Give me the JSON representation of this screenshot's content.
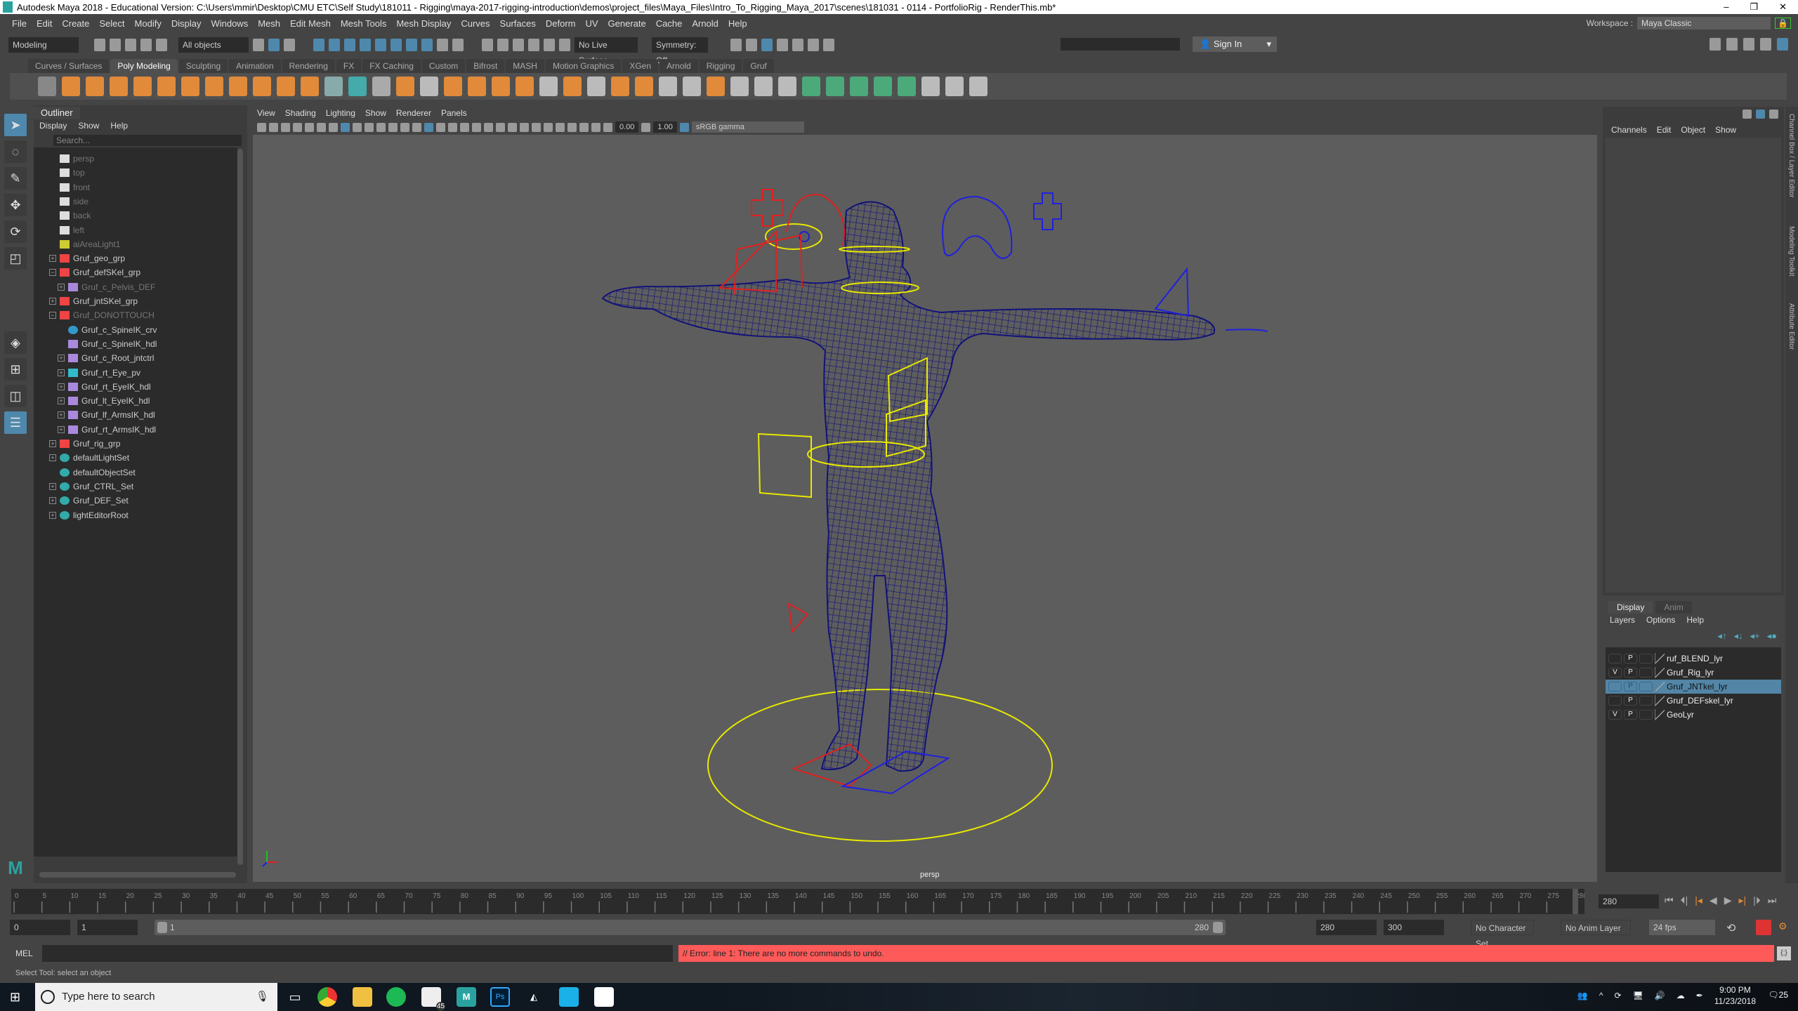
{
  "window": {
    "title": "Autodesk Maya 2018 - Educational Version: C:\\Users\\mmir\\Desktop\\CMU ETC\\Self Study\\181011 - Rigging\\maya-2017-rigging-introduction\\demos\\project_files\\Maya_Files\\Intro_To_Rigging_Maya_2017\\scenes\\181031 - 0114 - PortfolioRig - RenderThis.mb*",
    "logo": "M"
  },
  "menubar": [
    "File",
    "Edit",
    "Create",
    "Select",
    "Modify",
    "Display",
    "Windows",
    "Mesh",
    "Edit Mesh",
    "Mesh Tools",
    "Mesh Display",
    "Curves",
    "Surfaces",
    "Deform",
    "UV",
    "Generate",
    "Cache",
    "Arnold",
    "Help"
  ],
  "workspace": {
    "label": "Workspace :",
    "value": "Maya Classic"
  },
  "statusline": {
    "mode": "Modeling",
    "selection_mask": "All objects",
    "live_surface": "No Live Surface",
    "symmetry": "Symmetry: Off",
    "sign_in": "Sign In"
  },
  "shelf": {
    "tabs": [
      "Curves / Surfaces",
      "Poly Modeling",
      "Sculpting",
      "Animation",
      "Rendering",
      "FX",
      "FX Caching",
      "Custom",
      "Bifrost",
      "MASH",
      "Motion Graphics",
      "XGen",
      "Arnold",
      "Rigging",
      "Gruf"
    ],
    "active_tab": "Poly Modeling",
    "icon_colors": [
      "#888",
      "#e08a3a",
      "#e08a3a",
      "#e08a3a",
      "#e08a3a",
      "#e08a3a",
      "#e08a3a",
      "#e08a3a",
      "#e08a3a",
      "#e08a3a",
      "#e08a3a",
      "#e08a3a",
      "#8aa",
      "#4aa",
      "#aaa",
      "#e08a3a",
      "#bbb",
      "#e08a3a",
      "#e08a3a",
      "#e08a3a",
      "#e08a3a",
      "#bbb",
      "#e08a3a",
      "#bbb",
      "#e08a3a",
      "#e08a3a",
      "#bbb",
      "#bbb",
      "#e08a3a",
      "#bbb",
      "#bbb",
      "#bbb",
      "#4caa7a",
      "#4caa7a",
      "#4caa7a",
      "#4caa7a",
      "#4caa7a",
      "#bbb",
      "#bbb",
      "#bbb"
    ]
  },
  "outliner": {
    "title": "Outliner",
    "menu": [
      "Display",
      "Show",
      "Help"
    ],
    "search_placeholder": "Search...",
    "items": [
      {
        "name": "persp",
        "type": "camera",
        "depth": 0,
        "dim": true,
        "exp": ""
      },
      {
        "name": "top",
        "type": "camera",
        "depth": 0,
        "dim": true,
        "exp": ""
      },
      {
        "name": "front",
        "type": "camera",
        "depth": 0,
        "dim": true,
        "exp": ""
      },
      {
        "name": "side",
        "type": "camera",
        "depth": 0,
        "dim": true,
        "exp": ""
      },
      {
        "name": "back",
        "type": "camera",
        "depth": 0,
        "dim": true,
        "exp": ""
      },
      {
        "name": "left",
        "type": "camera",
        "depth": 0,
        "dim": true,
        "exp": ""
      },
      {
        "name": "aiAreaLight1",
        "type": "light",
        "depth": 0,
        "dim": true,
        "exp": ""
      },
      {
        "name": "Gruf_geo_grp",
        "type": "group",
        "depth": 0,
        "dim": false,
        "exp": "+"
      },
      {
        "name": "Gruf_defSKel_grp",
        "type": "group",
        "depth": 0,
        "dim": false,
        "exp": "-"
      },
      {
        "name": "Gruf_c_Pelvis_DEF",
        "type": "joint",
        "depth": 1,
        "dim": true,
        "exp": "+"
      },
      {
        "name": "Gruf_jntSKel_grp",
        "type": "group",
        "depth": 0,
        "dim": false,
        "exp": "+"
      },
      {
        "name": "Gruf_DONOTTOUCH",
        "type": "group",
        "depth": 0,
        "dim": true,
        "exp": "-"
      },
      {
        "name": "Gruf_c_SpineIK_crv",
        "type": "curve",
        "depth": 1,
        "dim": false,
        "exp": ""
      },
      {
        "name": "Gruf_c_SpineIK_hdl",
        "type": "ikhandle",
        "depth": 1,
        "dim": false,
        "exp": ""
      },
      {
        "name": "Gruf_c_Root_jntctrl",
        "type": "joint",
        "depth": 1,
        "dim": false,
        "exp": "+"
      },
      {
        "name": "Gruf_rt_Eye_pv",
        "type": "locator",
        "depth": 1,
        "dim": false,
        "exp": "+"
      },
      {
        "name": "Gruf_rt_EyeIK_hdl",
        "type": "ikhandle",
        "depth": 1,
        "dim": false,
        "exp": "+"
      },
      {
        "name": "Gruf_lt_EyeIK_hdl",
        "type": "ikhandle",
        "depth": 1,
        "dim": false,
        "exp": "+"
      },
      {
        "name": "Gruf_lf_ArmsIK_hdl",
        "type": "ikhandle",
        "depth": 1,
        "dim": false,
        "exp": "+"
      },
      {
        "name": "Gruf_rt_ArmsIK_hdl",
        "type": "ikhandle",
        "depth": 1,
        "dim": false,
        "exp": "+"
      },
      {
        "name": "Gruf_rig_grp",
        "type": "group",
        "depth": 0,
        "dim": false,
        "exp": "+"
      },
      {
        "name": "defaultLightSet",
        "type": "set",
        "depth": 0,
        "dim": false,
        "exp": "+"
      },
      {
        "name": "defaultObjectSet",
        "type": "set",
        "depth": 0,
        "dim": false,
        "exp": ""
      },
      {
        "name": "Gruf_CTRL_Set",
        "type": "set",
        "depth": 0,
        "dim": false,
        "exp": "+"
      },
      {
        "name": "Gruf_DEF_Set",
        "type": "set",
        "depth": 0,
        "dim": false,
        "exp": "+"
      },
      {
        "name": "lightEditorRoot",
        "type": "set",
        "depth": 0,
        "dim": false,
        "exp": "+"
      }
    ]
  },
  "viewport": {
    "menu": [
      "View",
      "Shading",
      "Lighting",
      "Show",
      "Renderer",
      "Panels"
    ],
    "exposure": "0.00",
    "gamma": "1.00",
    "color_space": "sRGB gamma",
    "camera": "persp",
    "wire_color": "#12127a",
    "bg_color": "#5d5d5d"
  },
  "channelbox": {
    "menu": [
      "Channels",
      "Edit",
      "Object",
      "Show"
    ],
    "side_tabs": [
      "Channel Box / Layer Editor",
      "Modeling Toolkit",
      "Attribute Editor"
    ]
  },
  "layer_editor": {
    "tabs": [
      "Display",
      "Anim"
    ],
    "active_tab": "Display",
    "menu": [
      "Layers",
      "Options",
      "Help"
    ],
    "layers": [
      {
        "name": "ruf_BLEND_lyr",
        "v": "",
        "p": "P",
        "selected": false
      },
      {
        "name": "Gruf_Rig_lyr",
        "v": "V",
        "p": "P",
        "selected": false
      },
      {
        "name": "Gruf_JNTkel_lyr",
        "v": "",
        "p": "P",
        "selected": true
      },
      {
        "name": "Gruf_DEFskel_lyr",
        "v": "",
        "p": "P",
        "selected": false
      },
      {
        "name": "GeoLyr",
        "v": "V",
        "p": "P",
        "selected": false
      }
    ]
  },
  "timeline": {
    "start": 0,
    "end": 280,
    "step": 5,
    "current_frame": "280"
  },
  "range": {
    "anim_start": "0",
    "playback_start": "1",
    "slider_start": "1",
    "slider_end": "280",
    "playback_end": "280",
    "anim_end": "300",
    "character_set": "No Character Set",
    "anim_layer": "No Anim Layer",
    "fps": "24 fps"
  },
  "command": {
    "lang": "MEL",
    "error": "// Error: line 1: There are no more commands to undo."
  },
  "helpline": "Select Tool: select an object",
  "taskbar": {
    "search_placeholder": "Type here to search",
    "time": "9:00 PM",
    "date": "11/23/2018",
    "notifications": "25",
    "mail_badge": "45"
  }
}
